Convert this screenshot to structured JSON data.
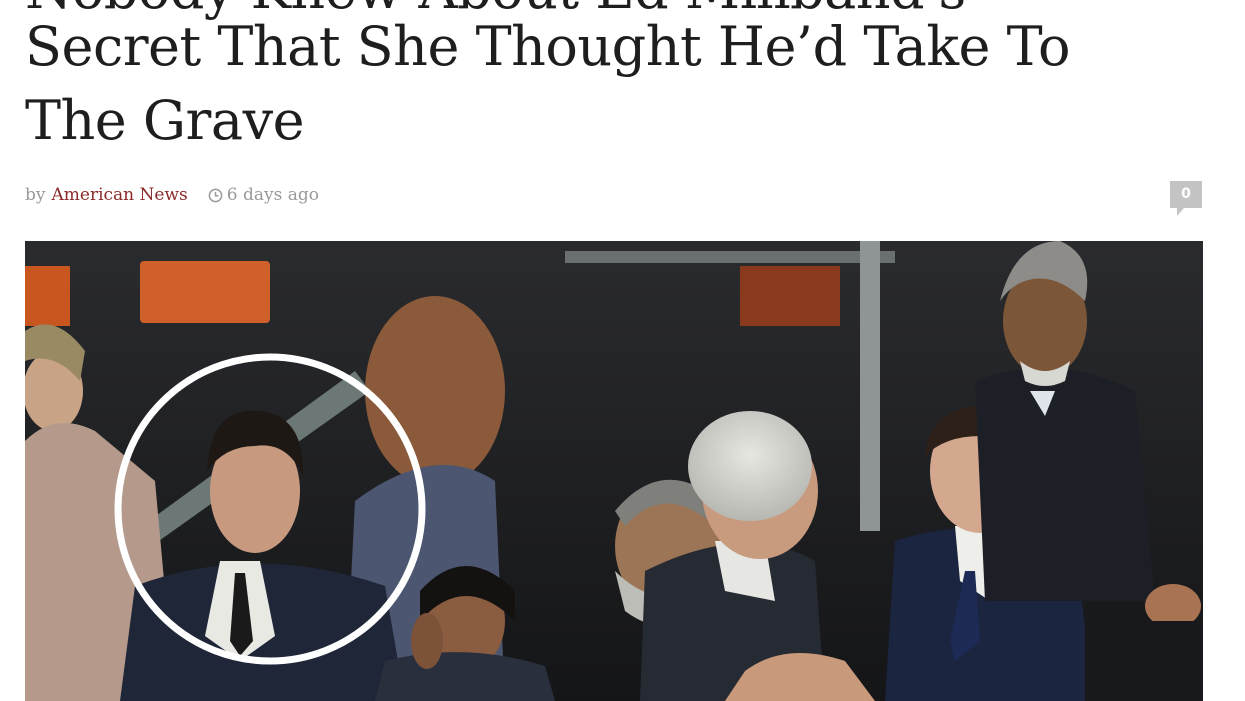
{
  "article": {
    "title_line_0": "Nobody Knew About Ed Miliband's",
    "title_line_1": "Secret That She Thought He’d Take To",
    "title_line_2": "The Grave"
  },
  "meta": {
    "by_label": "by",
    "author": "American News",
    "date": "6 days ago",
    "clock_icon": "clock-icon"
  },
  "comments": {
    "count": "0",
    "icon": "comment-bubble-icon",
    "color": "#c4c4c4"
  },
  "colors": {
    "author_link": "#8b2a2a",
    "meta_text": "#9a9a9a",
    "title_text": "#1e1e1e"
  }
}
